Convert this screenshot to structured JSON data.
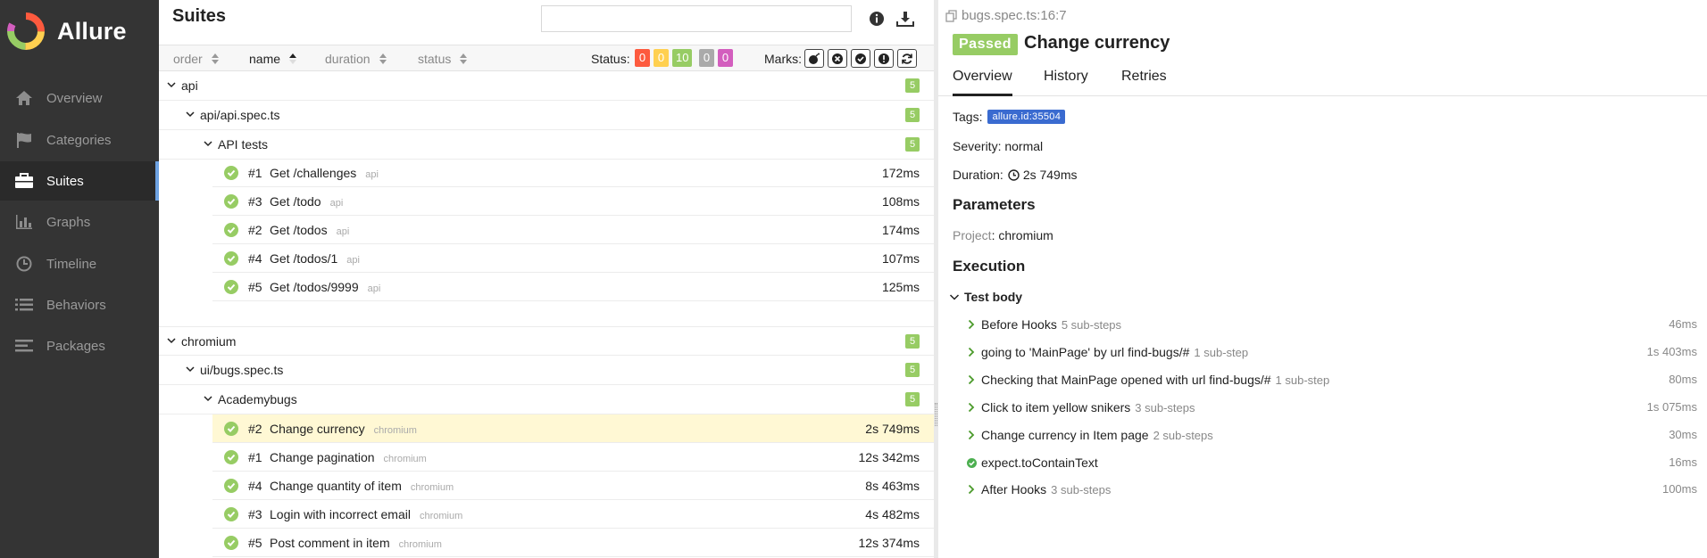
{
  "app": {
    "name": "Allure"
  },
  "nav": [
    {
      "label": "Overview",
      "icon": "home-icon"
    },
    {
      "label": "Categories",
      "icon": "flag-icon"
    },
    {
      "label": "Suites",
      "icon": "briefcase-icon",
      "active": true
    },
    {
      "label": "Graphs",
      "icon": "bar-chart-icon"
    },
    {
      "label": "Timeline",
      "icon": "clock-icon"
    },
    {
      "label": "Behaviors",
      "icon": "list-icon"
    },
    {
      "label": "Packages",
      "icon": "align-left-icon"
    }
  ],
  "suites": {
    "title": "Suites",
    "search": {
      "value": "",
      "placeholder": ""
    },
    "sort": {
      "order": "order",
      "name": "name",
      "duration": "duration",
      "status": "status"
    },
    "status_label": "Status:",
    "status_counts": [
      {
        "value": "0",
        "color": "#fd5a3e",
        "name": "failed"
      },
      {
        "value": "0",
        "color": "#ffd050",
        "name": "broken"
      },
      {
        "value": "10",
        "color": "#97cc64",
        "name": "passed"
      },
      {
        "value": "0",
        "color": "#aaaaaa",
        "name": "skipped"
      },
      {
        "value": "0",
        "color": "#d35ebe",
        "name": "unknown"
      }
    ],
    "marks_label": "Marks:"
  },
  "tree": {
    "api": {
      "name": "api",
      "count": "5",
      "file": {
        "name": "api/api.spec.ts",
        "count": "5"
      },
      "group": {
        "name": "API tests",
        "count": "5"
      },
      "tests": [
        {
          "num": "#1",
          "name": "Get /challenges",
          "tag": "api",
          "duration": "172ms"
        },
        {
          "num": "#3",
          "name": "Get /todo",
          "tag": "api",
          "duration": "108ms"
        },
        {
          "num": "#2",
          "name": "Get /todos",
          "tag": "api",
          "duration": "174ms"
        },
        {
          "num": "#4",
          "name": "Get /todos/1",
          "tag": "api",
          "duration": "107ms"
        },
        {
          "num": "#5",
          "name": "Get /todos/9999",
          "tag": "api",
          "duration": "125ms"
        }
      ]
    },
    "chromium": {
      "name": "chromium",
      "count": "5",
      "file": {
        "name": "ui/bugs.spec.ts",
        "count": "5"
      },
      "group": {
        "name": "Academybugs",
        "count": "5"
      },
      "tests": [
        {
          "num": "#2",
          "name": "Change currency",
          "tag": "chromium",
          "duration": "2s 749ms",
          "selected": true
        },
        {
          "num": "#1",
          "name": "Change pagination",
          "tag": "chromium",
          "duration": "12s 342ms"
        },
        {
          "num": "#4",
          "name": "Change quantity of item",
          "tag": "chromium",
          "duration": "8s 463ms"
        },
        {
          "num": "#3",
          "name": "Login with incorrect email",
          "tag": "chromium",
          "duration": "4s 482ms"
        },
        {
          "num": "#5",
          "name": "Post comment in item",
          "tag": "chromium",
          "duration": "12s 374ms"
        }
      ]
    }
  },
  "result": {
    "path": "bugs.spec.ts:16:7",
    "status": "Passed",
    "title": "Change currency",
    "tabs": [
      "Overview",
      "History",
      "Retries"
    ],
    "tags_label": "Tags:",
    "tag": "allure.id:35504",
    "severity": "Severity: normal",
    "duration_label": "Duration:",
    "duration": "2s 749ms",
    "parameters_heading": "Parameters",
    "param_key": "Project",
    "param_value": ": chromium",
    "execution_heading": "Execution",
    "test_body": "Test body",
    "steps": [
      {
        "name": "Before Hooks",
        "sub": "5 sub-steps",
        "duration": "46ms",
        "icon": "chevron-right-icon"
      },
      {
        "name": "going to 'MainPage' by url find-bugs/#",
        "sub": "1 sub-step",
        "duration": "1s 403ms",
        "icon": "chevron-right-icon"
      },
      {
        "name": "Checking that MainPage opened with url find-bugs/#",
        "sub": "1 sub-step",
        "duration": "80ms",
        "icon": "chevron-right-icon"
      },
      {
        "name": "Click to item yellow snikers",
        "sub": "3 sub-steps",
        "duration": "1s 075ms",
        "icon": "chevron-right-icon"
      },
      {
        "name": "Change currency in Item page",
        "sub": "2 sub-steps",
        "duration": "30ms",
        "icon": "chevron-right-icon"
      },
      {
        "name": "expect.toContainText",
        "sub": "",
        "duration": "16ms",
        "icon": "check-circle-icon"
      },
      {
        "name": "After Hooks",
        "sub": "3 sub-steps",
        "duration": "100ms",
        "icon": "chevron-right-icon"
      }
    ]
  }
}
